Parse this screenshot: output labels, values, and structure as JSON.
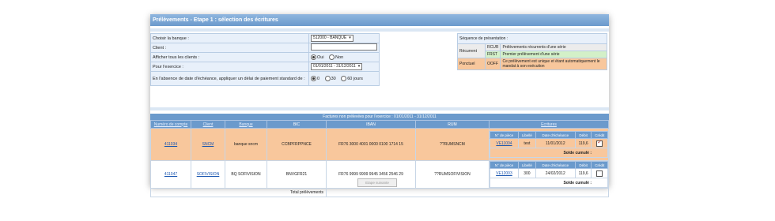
{
  "title": "Prélèvements - Etape 1 : sélection des écritures",
  "form": {
    "bank_label": "Choisir la banque :",
    "bank_value": "512000 - BANQUE",
    "client_label": "Client :",
    "client_value": "",
    "show_all_label": "Afficher tous les clients :",
    "show_all_options": [
      "Oui",
      "Non"
    ],
    "show_all_selected": "Oui",
    "exercise_label": "Pour l'exercice :",
    "exercise_value": "01/01/2011 - 31/12/2011",
    "delay_label": "En l'absence de date d'échéance, appliquer un délai de paiement standard de :",
    "delay_options": [
      "0",
      "30",
      "60 jours"
    ],
    "delay_selected": "0"
  },
  "sequence": {
    "header": "Séquence de présentation :",
    "recurrent_label": "Récurrent",
    "rcur_code": "RCUR",
    "rcur_desc": "Prélèvements récurrents d'une série",
    "frst_code": "FRST",
    "frst_desc": "Premier prélèvement d'une série",
    "ponctuel_label": "Ponctuel",
    "ooff_code": "OOFF",
    "ooff_desc": "Ce prélèvement est unique et étant automatiquement le mandat à son exécution"
  },
  "table": {
    "title": "Factures non prélevées pour l'exercice : 01/01/2011 - 31/12/2011",
    "headers": [
      "Numéro de compte",
      "Client",
      "Banque",
      "BIC",
      "IBAN",
      "RUM",
      "Ecritures"
    ],
    "inner_headers": [
      "N° de pièce",
      "Libellé",
      "Date d'échéance",
      "Débit",
      "Crédit"
    ],
    "rows": [
      {
        "account": "411034",
        "client": "SNCM",
        "bank": "banque sncm",
        "bic": "CCBPFRPPNCE",
        "iban": "FR76 3000 4001 0000 0100 1714 15",
        "rum": "??RUMSNCM",
        "piece": "VE11004",
        "libelle": "test",
        "date": "11/01/2012",
        "debit": "119,6",
        "credit": "",
        "checked": true,
        "solde": "Solde cumulé :"
      },
      {
        "account": "411047",
        "client": "SOFIVISION",
        "bank": "BQ SOFIVISION",
        "bic": "BNVGFR21",
        "iban": "FR76 9999 9999 9945 3456 2546 29",
        "rum": "??RUMSOFIVISION",
        "piece": "VE12003",
        "libelle": "300",
        "date": "24/02/2012",
        "debit": "119,6",
        "credit": "",
        "checked": false,
        "solde": "Solde cumulé :"
      }
    ],
    "total_label": "Total prélèvements",
    "next_button": "Etape suivante"
  }
}
